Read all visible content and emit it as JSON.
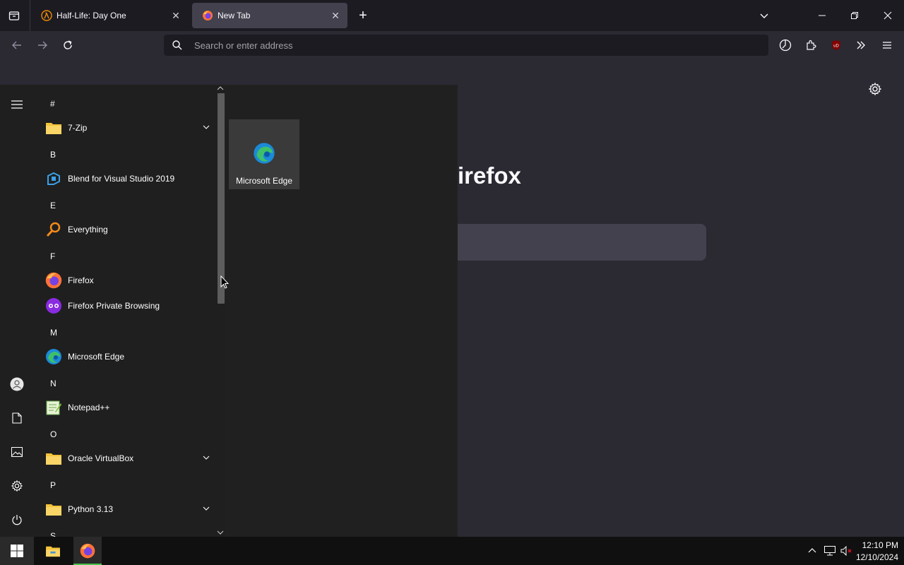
{
  "browser": {
    "tabs": [
      {
        "title": "Half-Life: Day One",
        "favicon": "half-life-lambda-icon",
        "active": false
      },
      {
        "title": "New Tab",
        "favicon": "firefox-icon",
        "active": true
      }
    ],
    "address_placeholder": "Search or enter address",
    "newtab": {
      "brand_fragment": "irefox"
    }
  },
  "start_menu": {
    "sections": [
      {
        "letter": "#",
        "apps": [
          {
            "label": "7-Zip",
            "icon": "folder-icon",
            "expandable": true
          }
        ]
      },
      {
        "letter": "B",
        "apps": [
          {
            "label": "Blend for Visual Studio 2019",
            "icon": "blend-icon"
          }
        ]
      },
      {
        "letter": "E",
        "apps": [
          {
            "label": "Everything",
            "icon": "everything-search-icon"
          }
        ]
      },
      {
        "letter": "F",
        "apps": [
          {
            "label": "Firefox",
            "icon": "firefox-icon"
          },
          {
            "label": "Firefox Private Browsing",
            "icon": "firefox-private-icon"
          }
        ]
      },
      {
        "letter": "M",
        "apps": [
          {
            "label": "Microsoft Edge",
            "icon": "edge-icon"
          }
        ]
      },
      {
        "letter": "N",
        "apps": [
          {
            "label": "Notepad++",
            "icon": "notepadpp-icon"
          }
        ]
      },
      {
        "letter": "O",
        "apps": [
          {
            "label": "Oracle VirtualBox",
            "icon": "folder-icon",
            "expandable": true
          }
        ]
      },
      {
        "letter": "P",
        "apps": [
          {
            "label": "Python 3.13",
            "icon": "folder-icon",
            "expandable": true
          }
        ]
      },
      {
        "letter": "S",
        "apps": []
      }
    ],
    "pinned_tile": {
      "label": "Microsoft Edge",
      "icon": "edge-icon"
    }
  },
  "taskbar": {
    "time": "12:10 PM",
    "date": "12/10/2024"
  },
  "colors": {
    "accent_green": "#4cc24c",
    "folder_yellow": "#f3c33b",
    "ublock_red": "#800000"
  }
}
